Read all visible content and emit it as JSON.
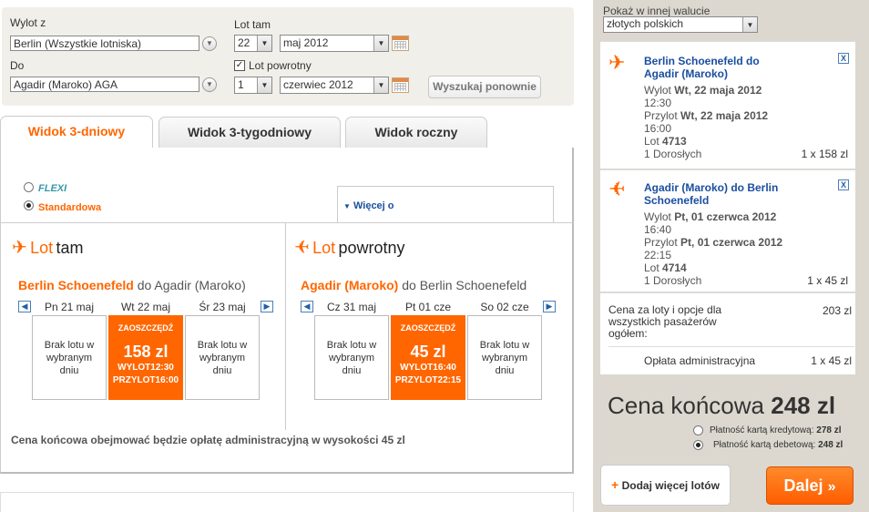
{
  "search": {
    "from_label": "Wylot z",
    "from_value": "Berlin (Wszystkie lotniska)",
    "to_label": "Do",
    "to_value": "Agadir (Maroko) AGA",
    "outbound_label": "Lot tam",
    "outbound_day": "22",
    "outbound_month": "maj 2012",
    "return_label": "Lot powrotny",
    "return_checked": true,
    "return_day": "1",
    "return_month": "czerwiec 2012",
    "search_again": "Wyszukaj ponownie"
  },
  "tabs": [
    {
      "label": "Widok 3-dniowy",
      "active": true
    },
    {
      "label": "Widok 3-tygodniowy",
      "active": false
    },
    {
      "label": "Widok roczny",
      "active": false
    }
  ],
  "fares": {
    "flexi": "FLEXI",
    "standard": "Standardowa",
    "more": "Więcej o"
  },
  "outbound": {
    "title_prefix": "Lot",
    "title_main": "tam",
    "from": "Berlin Schoenefeld",
    "to_text": "do Agadir (Maroko)",
    "days": [
      {
        "header": "Pn 21 maj",
        "no_flight": "Brak lotu w wybranym dniu"
      },
      {
        "header": "Wt 22 maj",
        "save": "ZAOSZCZĘDŹ",
        "price": "158 zl",
        "dep": "WYLOT12:30",
        "arr": "PRZYLOT16:00"
      },
      {
        "header": "Śr 23 maj",
        "no_flight": "Brak lotu w wybranym dniu"
      }
    ]
  },
  "return": {
    "title_prefix": "Lot",
    "title_main": "powrotny",
    "from": "Agadir (Maroko)",
    "to_text": "do Berlin Schoenefeld",
    "days": [
      {
        "header": "Cz 31 maj",
        "no_flight": "Brak lotu w wybranym dniu"
      },
      {
        "header": "Pt 01 cze",
        "save": "ZAOSZCZĘDŹ",
        "price": "45 zl",
        "dep": "WYLOT16:40",
        "arr": "PRZYLOT22:15"
      },
      {
        "header": "So 02 cze",
        "no_flight": "Brak lotu w wybranym dniu"
      }
    ]
  },
  "fee_note": "Cena końcowa obejmować będzie opłatę administracyjną w wysokości 45 zl",
  "sidebar": {
    "currency_label": "Pokaż w innej walucie",
    "currency_value": "złotych polskich",
    "flight1": {
      "route": "Berlin Schoenefeld do Agadir (Maroko)",
      "dep_label": "Wylot",
      "dep_date": "Wt, 22 maja 2012",
      "dep_time": "12:30",
      "arr_label": "Przylot",
      "arr_date": "Wt, 22 maja 2012",
      "arr_time": "16:00",
      "flight_label": "Lot",
      "flight_no": "4713",
      "pax": "1 Dorosłych",
      "price": "1 x 158 zl"
    },
    "flight2": {
      "route": "Agadir (Maroko) do Berlin Schoenefeld",
      "dep_label": "Wylot",
      "dep_date": "Pt, 01 czerwca 2012",
      "dep_time": "16:40",
      "arr_label": "Przylot",
      "arr_date": "Pt, 01 czerwca 2012",
      "arr_time": "22:15",
      "flight_label": "Lot",
      "flight_no": "4714",
      "pax": "1 Dorosłych",
      "price": "1 x 45 zl"
    },
    "subtotal_label": "Cena za loty i opcje dla wszystkich pasażerów ogółem:",
    "subtotal_value": "203 zl",
    "admin_label": "Opłata administracyjna",
    "admin_value": "1 x 45 zl",
    "final_label": "Cena końcowa",
    "final_value": "248 zl",
    "credit_label": "Płatność kartą kredytową:",
    "credit_value": "278 zl",
    "debit_label": "Płatność kartą debetową:",
    "debit_value": "248 zl",
    "add_flights": "Dodaj więcej lotów",
    "next": "Dalej"
  },
  "colors": {
    "accent": "#ff6600",
    "link": "#1a4ea0",
    "teal": "#3399aa"
  }
}
